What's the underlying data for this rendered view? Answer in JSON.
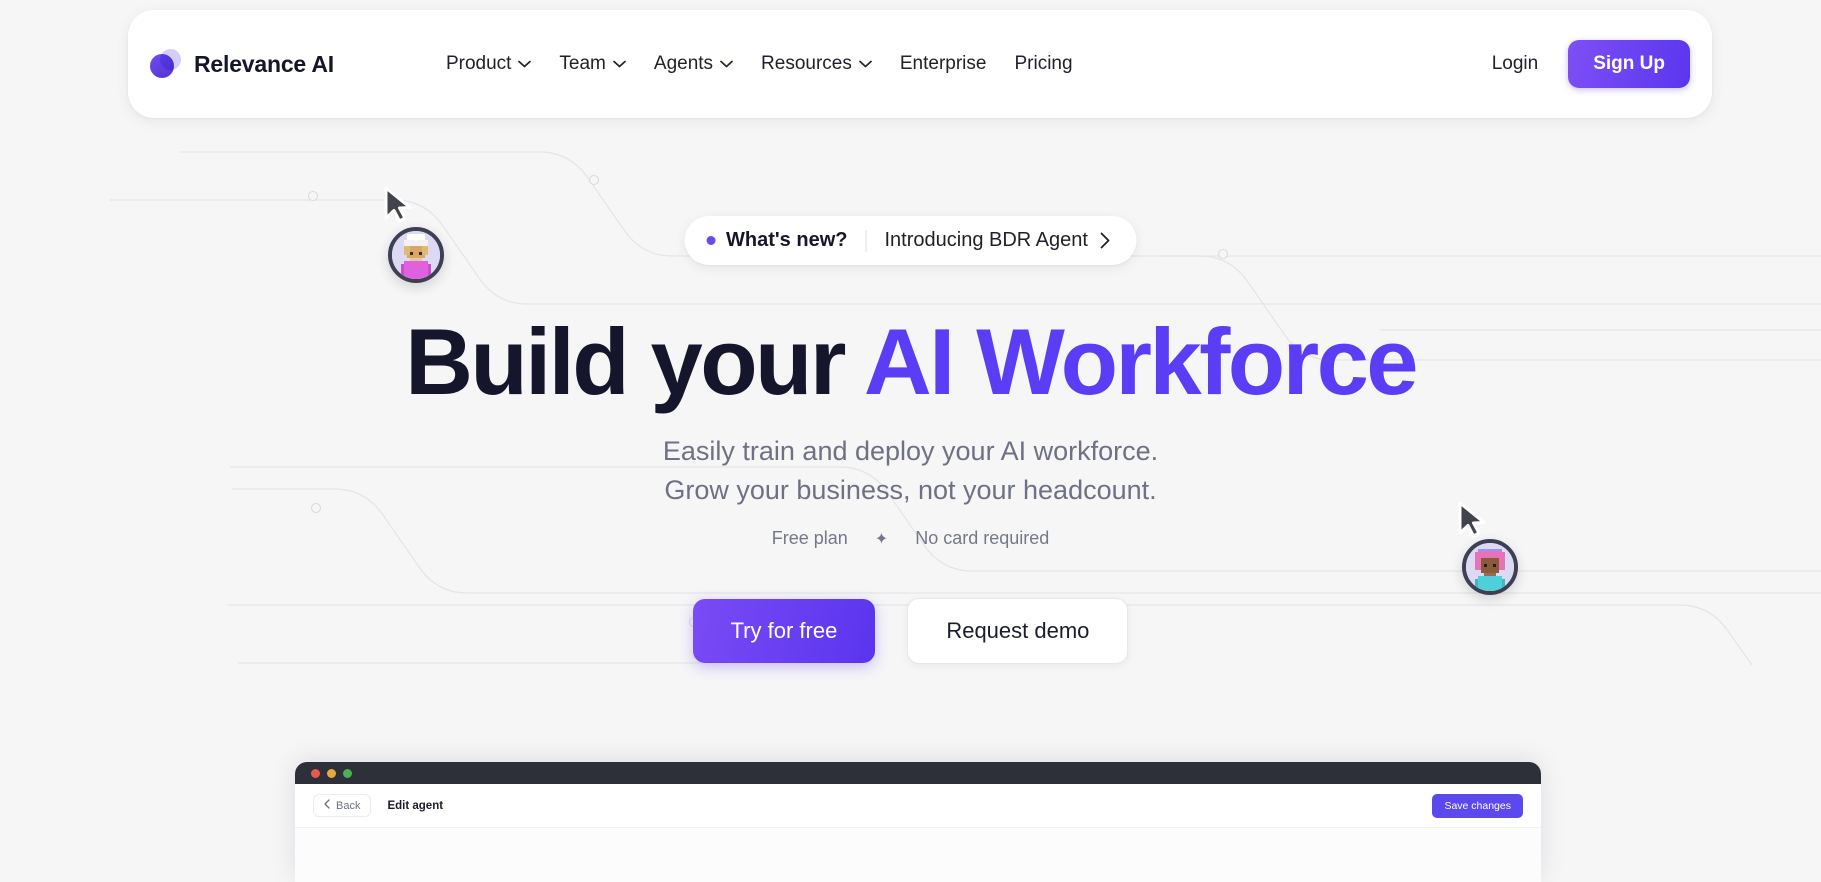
{
  "brand": {
    "name": "Relevance AI",
    "logo_icon": "relevance-logo-icon"
  },
  "nav": {
    "items": [
      {
        "label": "Product",
        "has_dropdown": true
      },
      {
        "label": "Team",
        "has_dropdown": true
      },
      {
        "label": "Agents",
        "has_dropdown": true
      },
      {
        "label": "Resources",
        "has_dropdown": true
      },
      {
        "label": "Enterprise",
        "has_dropdown": false
      },
      {
        "label": "Pricing",
        "has_dropdown": false
      }
    ],
    "login_label": "Login",
    "signup_label": "Sign Up"
  },
  "announcement": {
    "dot_color": "#6a47ef",
    "label": "What's new?",
    "text": "Introducing BDR Agent",
    "chevron_icon": "chevron-right-icon"
  },
  "hero": {
    "headline_plain": "Build your ",
    "headline_accent": "AI Workforce",
    "subhead_line_1": "Easily train and deploy your AI workforce.",
    "subhead_line_2": "Grow your business, not your headcount.",
    "meta_left": "Free plan",
    "meta_separator": "✦",
    "meta_right": "No card required",
    "cta_primary": "Try for free",
    "cta_secondary": "Request demo",
    "accent_color": "#5b3df5"
  },
  "avatars": [
    {
      "name": "avatar-chef-pixel",
      "ring_color": "#3d3f52"
    },
    {
      "name": "avatar-pink-pixel",
      "ring_color": "#3d3f52"
    }
  ],
  "app_window": {
    "traffic_lights": [
      "#e8584b",
      "#e9a83a",
      "#4cb14f"
    ],
    "back_label": "Back",
    "back_icon": "chevron-left-icon",
    "title": "Edit agent",
    "save_label": "Save changes",
    "save_color": "#5b48ef"
  }
}
